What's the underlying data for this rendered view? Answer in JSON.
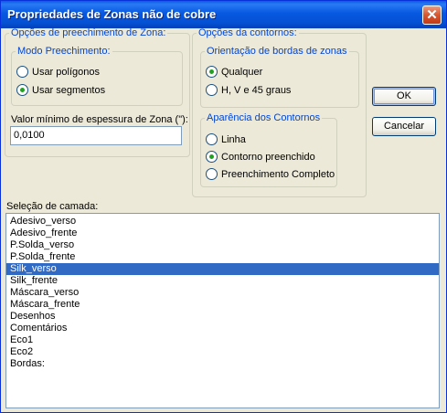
{
  "window": {
    "title": "Propriedades de Zonas não de cobre"
  },
  "fill_options": {
    "legend": "Opções de preechimento de Zona:",
    "mode_group": {
      "legend": "Modo Preechimento:",
      "options": [
        {
          "label": "Usar polígonos",
          "selected": false
        },
        {
          "label": "Usar segmentos",
          "selected": true
        }
      ]
    },
    "min_thickness": {
      "label": "Valor mínimo de espessura de Zona (\"):",
      "value": "0,0100"
    }
  },
  "contour_options": {
    "legend": "Opções da contornos:",
    "orientation_group": {
      "legend": "Orientação de bordas de zonas",
      "options": [
        {
          "label": "Qualquer",
          "selected": true
        },
        {
          "label": "H, V e 45 graus",
          "selected": false
        }
      ]
    },
    "appearance_group": {
      "legend": "Aparência dos Contornos",
      "options": [
        {
          "label": "Linha",
          "selected": false
        },
        {
          "label": "Contorno preenchido",
          "selected": true
        },
        {
          "label": "Preenchimento Completo",
          "selected": false
        }
      ]
    }
  },
  "buttons": {
    "ok": "OK",
    "cancel": "Cancelar"
  },
  "layers": {
    "label": "Seleção de camada:",
    "items": [
      "Adesivo_verso",
      "Adesivo_frente",
      "P.Solda_verso",
      "P.Solda_frente",
      "Silk_verso",
      "Silk_frente",
      "Máscara_verso",
      "Máscara_frente",
      "Desenhos",
      "Comentários",
      "Eco1",
      "Eco2",
      "Bordas:"
    ],
    "selected": "Silk_verso"
  },
  "colors": {
    "titlebar": "#0758e0",
    "dialog_bg": "#ece9d8",
    "legend_text": "#0046d5",
    "selection": "#316ac5"
  }
}
